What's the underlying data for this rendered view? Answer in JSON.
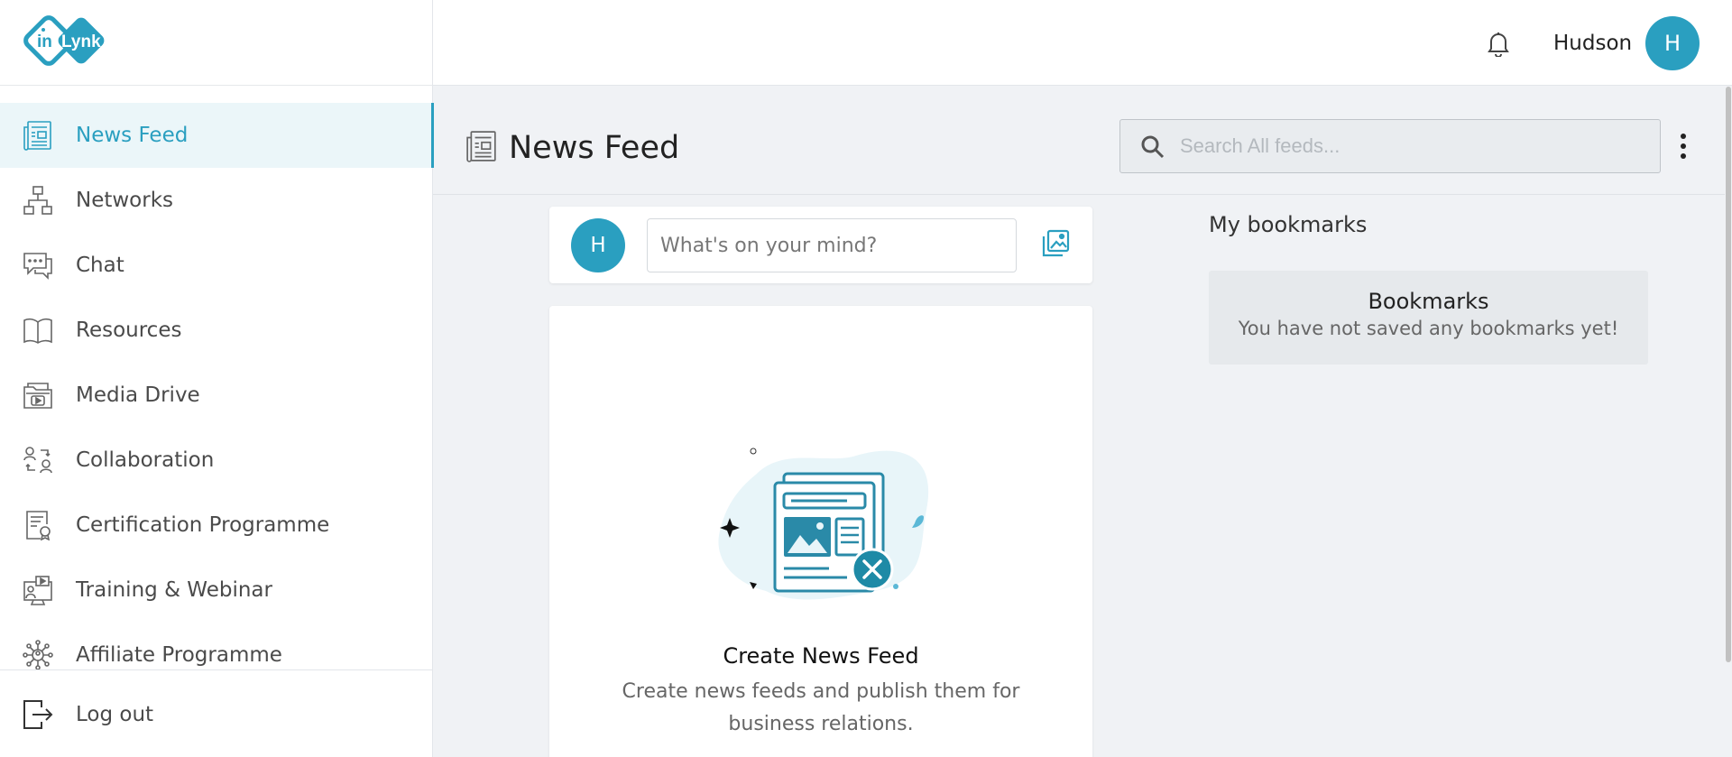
{
  "app": {
    "logo_text_left": "in",
    "logo_text_right": "Lynk"
  },
  "sidebar": {
    "items": [
      {
        "label": "News Feed",
        "icon": "news-icon",
        "active": true
      },
      {
        "label": "Networks",
        "icon": "network-icon"
      },
      {
        "label": "Chat",
        "icon": "chat-icon"
      },
      {
        "label": "Resources",
        "icon": "book-icon"
      },
      {
        "label": "Media Drive",
        "icon": "media-drive-icon"
      },
      {
        "label": "Collaboration",
        "icon": "collaboration-icon"
      },
      {
        "label": "Certification Programme",
        "icon": "certificate-icon"
      },
      {
        "label": "Training & Webinar",
        "icon": "webinar-icon"
      },
      {
        "label": "Affiliate Programme",
        "icon": "affiliate-icon"
      }
    ],
    "logout_label": "Log out"
  },
  "topbar": {
    "username": "Hudson",
    "avatar_initial": "H"
  },
  "header": {
    "title": "News Feed",
    "search_placeholder": "Search All feeds..."
  },
  "composer": {
    "avatar_initial": "H",
    "placeholder": "What's on your mind?"
  },
  "empty_state": {
    "title": "Create News Feed",
    "description": "Create news feeds and publish them for business relations."
  },
  "bookmarks": {
    "heading": "My bookmarks",
    "box_title": "Bookmarks",
    "box_text": "You have not saved any bookmarks yet!"
  },
  "colors": {
    "accent": "#2a9fc0",
    "active_bg": "#ebf6f9",
    "page_bg": "#f0f2f5"
  }
}
